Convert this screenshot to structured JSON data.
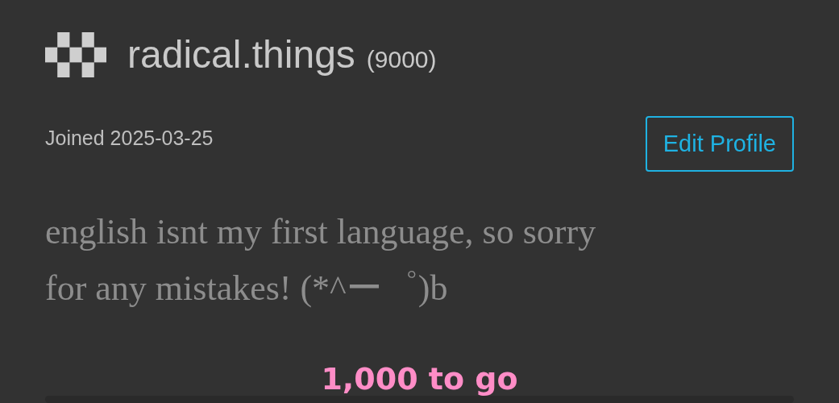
{
  "profile": {
    "username": "radical.things",
    "points": "(9000)",
    "joined": "Joined 2025-03-25",
    "edit_button": "Edit Profile",
    "bio": [
      "english isnt my first language, so sorry",
      "for any mistakes! (*^ー゜)b"
    ]
  },
  "caption": "1,000 to go"
}
